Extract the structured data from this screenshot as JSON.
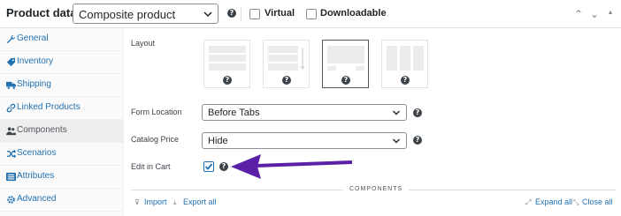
{
  "header": {
    "title": "Product data —",
    "product_type": "Composite product",
    "virtual_label": "Virtual",
    "downloadable_label": "Downloadable",
    "help_glyph": "?",
    "arrows": [
      "⌃",
      "⌄",
      "▴"
    ]
  },
  "sidebar": {
    "items": [
      {
        "label": "General",
        "icon": "wrench-icon"
      },
      {
        "label": "Inventory",
        "icon": "tag-icon"
      },
      {
        "label": "Shipping",
        "icon": "truck-icon"
      },
      {
        "label": "Linked Products",
        "icon": "link-icon"
      },
      {
        "label": "Components",
        "icon": "people-icon",
        "active": true
      },
      {
        "label": "Scenarios",
        "icon": "shuffle-icon"
      },
      {
        "label": "Attributes",
        "icon": "list-icon"
      },
      {
        "label": "Advanced",
        "icon": "gear-icon"
      }
    ]
  },
  "main": {
    "layout_label": "Layout",
    "layout_selected_index": 2,
    "form_location_label": "Form Location",
    "form_location_value": "Before Tabs",
    "catalog_price_label": "Catalog Price",
    "catalog_price_value": "Hide",
    "edit_in_cart_label": "Edit in Cart",
    "edit_in_cart_checked": true,
    "section_title": "COMPONENTS",
    "import_label": "Import",
    "export_label": "Export all",
    "expand_label": "Expand all",
    "close_label": "Close all"
  },
  "colors": {
    "link": "#2271b1",
    "annotation_arrow": "#5b1fa8",
    "text": "#1d2327"
  }
}
